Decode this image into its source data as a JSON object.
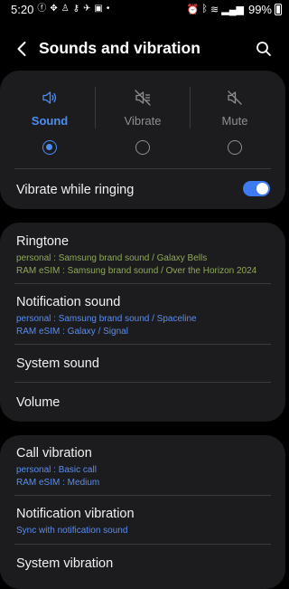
{
  "status_bar": {
    "time": "5:20",
    "battery": "99%"
  },
  "header": {
    "title": "Sounds and vibration"
  },
  "mode": {
    "options": [
      {
        "label": "Sound"
      },
      {
        "label": "Vibrate"
      },
      {
        "label": "Mute"
      }
    ],
    "selected": "Sound",
    "accent_color": "#4b8ef5"
  },
  "vibrate_while_ringing": {
    "label": "Vibrate while ringing",
    "enabled": true
  },
  "sounds": {
    "ringtone": {
      "title": "Ringtone",
      "lines": [
        "personal  : Samsung brand sound / Galaxy Bells",
        "RAM eSIM : Samsung brand sound / Over the Horizon 2024"
      ]
    },
    "notification_sound": {
      "title": "Notification sound",
      "lines": [
        "personal  : Samsung brand sound / Spaceline",
        "RAM eSIM : Galaxy / Signal"
      ]
    },
    "system_sound": {
      "title": "System sound"
    },
    "volume": {
      "title": "Volume"
    }
  },
  "vibration": {
    "call_vibration": {
      "title": "Call vibration",
      "lines": [
        "personal  : Basic call",
        "RAM eSIM : Medium"
      ]
    },
    "notification_vibration": {
      "title": "Notification vibration",
      "lines": [
        "Sync with notification sound"
      ]
    },
    "system_vibration": {
      "title": "System vibration"
    }
  }
}
